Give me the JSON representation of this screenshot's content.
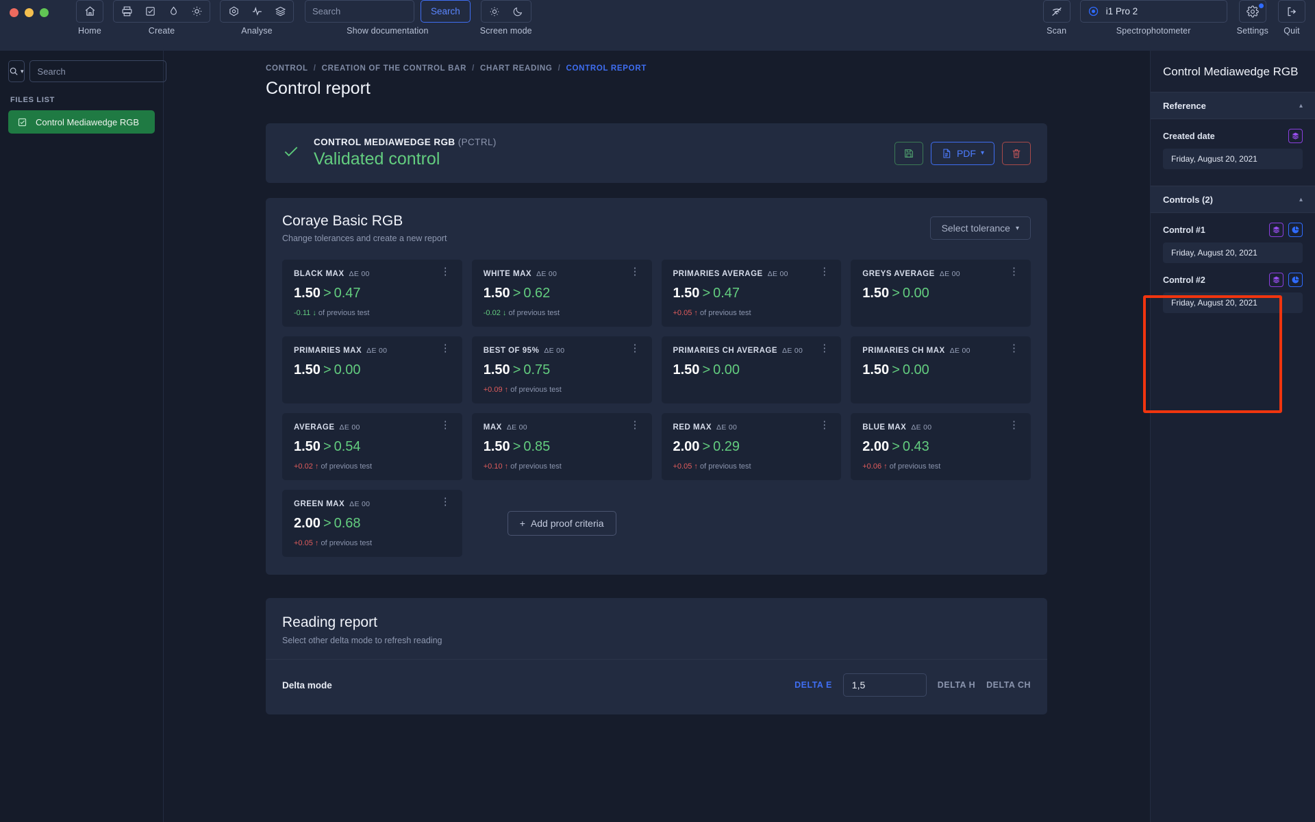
{
  "window": {
    "traffic_lights": [
      "close",
      "minimize",
      "zoom"
    ]
  },
  "toolbar": {
    "groups": [
      {
        "label": "Home",
        "icons": [
          "home-icon"
        ]
      },
      {
        "label": "Create",
        "icons": [
          "printer-icon",
          "check-square-icon",
          "droplet-icon",
          "sun-icon"
        ]
      },
      {
        "label": "Analyse",
        "icons": [
          "target-icon",
          "activity-icon",
          "layers-icon"
        ]
      }
    ],
    "search": {
      "placeholder": "Search",
      "value": "",
      "button_label": "Search",
      "label": "Show documentation"
    },
    "screen_mode": {
      "label": "Screen mode",
      "icons": [
        "sun-icon",
        "moon-icon"
      ]
    },
    "scan": {
      "label": "Scan",
      "icon": "scan-off-icon"
    },
    "spectrophotometer": {
      "label": "Spectrophotometer",
      "device": "i1 Pro 2",
      "icon": "target-circle-icon"
    },
    "settings": {
      "label": "Settings",
      "icon": "gear-icon",
      "has_badge": true
    },
    "quit": {
      "label": "Quit",
      "icon": "logout-icon"
    }
  },
  "sidebar": {
    "search": {
      "placeholder": "Search",
      "value": "",
      "filter_icon": "search-icon",
      "caret": "chevron-down-icon"
    },
    "section_label": "FILES LIST",
    "files": [
      {
        "label": "Control Mediawedge RGB",
        "icon": "check-square-icon",
        "selected": true
      }
    ]
  },
  "breadcrumb": {
    "items": [
      "CONTROL",
      "CREATION OF THE CONTROL BAR",
      "CHART READING",
      "CONTROL REPORT"
    ],
    "active_index": 3,
    "separator": "/"
  },
  "page": {
    "title": "Control report"
  },
  "validated_banner": {
    "check_icon": "check-icon",
    "name": "CONTROL MEDIAWEDGE RGB",
    "code": "(PCTRL)",
    "status": "Validated control",
    "actions": [
      {
        "name": "save",
        "icon": "save-icon",
        "label": ""
      },
      {
        "name": "pdf",
        "icon": "file-text-icon",
        "label": "PDF",
        "caret": "▾"
      },
      {
        "name": "delete",
        "icon": "trash-icon",
        "label": ""
      }
    ]
  },
  "tolerance_panel": {
    "title": "Coraye Basic RGB",
    "subtitle": "Change tolerances and create a new report",
    "select_tolerance_label": "Select tolerance",
    "add_criteria_label": "Add proof criteria",
    "unit": "ΔE 00",
    "separator": ">",
    "delta_suffix": "of previous test",
    "cards": [
      {
        "name": "BLACK MAX",
        "unit": "ΔE 00",
        "tolerance": "1.50",
        "value": "0.47",
        "delta": "-0.11",
        "direction": "down"
      },
      {
        "name": "WHITE MAX",
        "unit": "ΔE 00",
        "tolerance": "1.50",
        "value": "0.62",
        "delta": "-0.02",
        "direction": "down"
      },
      {
        "name": "PRIMARIES AVERAGE",
        "unit": "ΔE 00",
        "tolerance": "1.50",
        "value": "0.47",
        "delta": "+0.05",
        "direction": "up"
      },
      {
        "name": "GREYS AVERAGE",
        "unit": "ΔE 00",
        "tolerance": "1.50",
        "value": "0.00",
        "delta": "",
        "direction": ""
      },
      {
        "name": "PRIMARIES MAX",
        "unit": "ΔE 00",
        "tolerance": "1.50",
        "value": "0.00",
        "delta": "",
        "direction": ""
      },
      {
        "name": "BEST OF 95%",
        "unit": "ΔE 00",
        "tolerance": "1.50",
        "value": "0.75",
        "delta": "+0.09",
        "direction": "up"
      },
      {
        "name": "PRIMARIES CH AVERAGE",
        "unit": "ΔE 00",
        "tolerance": "1.50",
        "value": "0.00",
        "delta": "",
        "direction": ""
      },
      {
        "name": "PRIMARIES CH MAX",
        "unit": "ΔE 00",
        "tolerance": "1.50",
        "value": "0.00",
        "delta": "",
        "direction": ""
      },
      {
        "name": "AVERAGE",
        "unit": "ΔE 00",
        "tolerance": "1.50",
        "value": "0.54",
        "delta": "+0.02",
        "direction": "up"
      },
      {
        "name": "MAX",
        "unit": "ΔE 00",
        "tolerance": "1.50",
        "value": "0.85",
        "delta": "+0.10",
        "direction": "up"
      },
      {
        "name": "RED MAX",
        "unit": "ΔE 00",
        "tolerance": "2.00",
        "value": "0.29",
        "delta": "+0.05",
        "direction": "up"
      },
      {
        "name": "BLUE MAX",
        "unit": "ΔE 00",
        "tolerance": "2.00",
        "value": "0.43",
        "delta": "+0.06",
        "direction": "up"
      },
      {
        "name": "GREEN MAX",
        "unit": "ΔE 00",
        "tolerance": "2.00",
        "value": "0.68",
        "delta": "+0.05",
        "direction": "up"
      }
    ]
  },
  "reading_report": {
    "title": "Reading report",
    "subtitle": "Select other delta mode to refresh reading",
    "delta_mode_label": "Delta mode",
    "modes": [
      {
        "label": "DELTA E",
        "active": true
      },
      {
        "label": "DELTA H",
        "active": false
      },
      {
        "label": "DELTA CH",
        "active": false
      }
    ],
    "value_input": {
      "value": "1,5",
      "placeholder": ""
    }
  },
  "right_panel": {
    "title": "Control Mediawedge RGB",
    "reference": {
      "header": "Reference",
      "caret": "chevron-up-icon",
      "created_date_label": "Created date",
      "created_date_value": "Friday, August 20, 2021",
      "icon": "layers-icon"
    },
    "controls": {
      "header": "Controls (2)",
      "caret": "chevron-up-icon",
      "highlighted": true,
      "highlight_color": "#f0350f",
      "items": [
        {
          "label": "Control #1",
          "date": "Friday, August 20, 2021",
          "icons": [
            "layers-icon",
            "pie-chart-icon"
          ]
        },
        {
          "label": "Control #2",
          "date": "Friday, August 20, 2021",
          "icons": [
            "layers-icon",
            "pie-chart-icon"
          ]
        }
      ]
    }
  },
  "colors": {
    "page_bg": "#161c2b",
    "panel_bg": "#222b40",
    "card_bg": "#1b2335",
    "accent_blue": "#3f6ef2",
    "accent_green": "#63cd7f",
    "accent_red": "#e05c5c",
    "accent_purple": "#9a4ff0",
    "highlight": "#f0350f"
  }
}
